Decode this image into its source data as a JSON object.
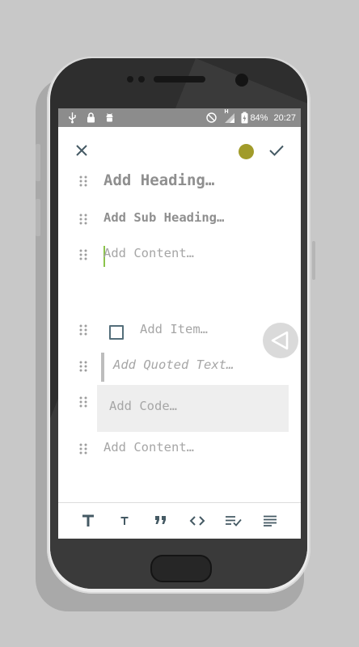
{
  "status_bar": {
    "left_icons": [
      "usb-icon",
      "lock-icon",
      "android-debug-icon"
    ],
    "battery": "84%",
    "time": "20:27",
    "signal_label": "H"
  },
  "editor_toolbar": {
    "close_icon": "close-icon",
    "color_dot": "#a19b2a",
    "check_icon": "check-icon"
  },
  "blocks": [
    {
      "type": "heading",
      "placeholder": "Add Heading…"
    },
    {
      "type": "subheading",
      "placeholder": "Add Sub Heading…"
    },
    {
      "type": "content",
      "placeholder": "Add Content…"
    },
    {
      "type": "checklist",
      "placeholder": "Add Item…"
    },
    {
      "type": "quote",
      "placeholder": "Add Quoted Text…"
    },
    {
      "type": "code",
      "placeholder": "Add Code…"
    },
    {
      "type": "content",
      "placeholder": "Add Content…"
    }
  ],
  "format_bar": [
    "heading-format-icon",
    "subheading-format-icon",
    "quote-format-icon",
    "code-format-icon",
    "checklist-format-icon",
    "text-format-icon"
  ],
  "colors": {
    "accent": "#8bc34a",
    "icon": "#455a64",
    "status_bar": "#8c8c8c"
  }
}
